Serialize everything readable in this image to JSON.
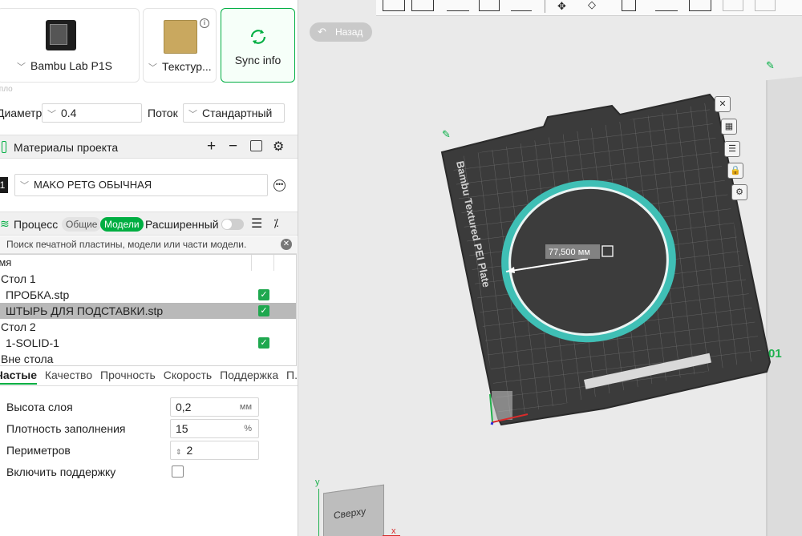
{
  "printer": {
    "name": "Bambu Lab P1S",
    "plate_name": "Текстур...",
    "sync_label": "Sync info"
  },
  "nozzle": {
    "section_label": "Сопло",
    "diameter_label": "Диаметр",
    "diameter_value": "0.4",
    "flow_label": "Поток",
    "flow_value": "Стандартный"
  },
  "materials": {
    "title": "Материалы проекта",
    "index": "1",
    "filament": "MAKO PETG ОБЫЧНАЯ"
  },
  "process": {
    "title": "Процесс",
    "tab_common": "Общие",
    "tab_models": "Модели",
    "advanced_label": "Расширенный"
  },
  "search": {
    "placeholder": "Поиск печатной пластины, модели или части модели."
  },
  "objects": {
    "header": "Имя",
    "rows": [
      {
        "label": "Стол 1",
        "checked": false
      },
      {
        "label": "ПРОБКА.stp",
        "checked": true
      },
      {
        "label": "ШТЫРЬ ДЛЯ ПОДСТАВКИ.stp",
        "checked": true,
        "selected": true
      },
      {
        "label": "Стол 2",
        "checked": false
      },
      {
        "label": "1-SOLID-1",
        "checked": true
      },
      {
        "label": "Вне стола",
        "checked": false
      }
    ]
  },
  "settings_tabs": [
    "Частые",
    "Качество",
    "Прочность",
    "Скорость",
    "Поддержка",
    "П..."
  ],
  "params": {
    "layer_height_label": "Высота слоя",
    "layer_height_value": "0,2",
    "layer_height_unit": "мм",
    "infill_label": "Плотность заполнения",
    "infill_value": "15",
    "infill_unit": "%",
    "walls_label": "Периметров",
    "walls_value": "2",
    "support_label": "Включить поддержку"
  },
  "viewport": {
    "back_label": "Назад",
    "plate_text": "Bambu Textured PEI Plate",
    "measure_label": "77,500 мм",
    "plate_number": "01",
    "view_cube_label": "Сверху",
    "axis_x": "x",
    "axis_y": "y"
  },
  "colors": {
    "accent": "#00ae42",
    "plate": "#3b3b3b",
    "ring": "#3fbfb5"
  }
}
